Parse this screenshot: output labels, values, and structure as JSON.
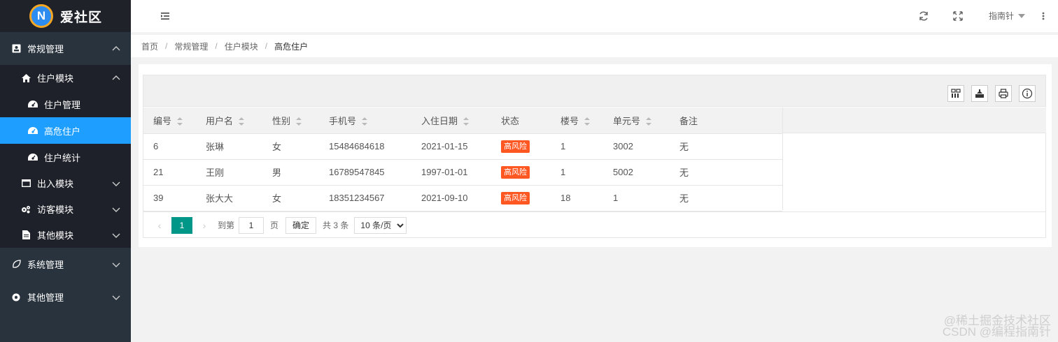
{
  "app": {
    "logo_letter": "N",
    "title": "爱社区"
  },
  "sidebar": {
    "groups": [
      {
        "label": "常规管理",
        "icon": "contact-card-icon",
        "expanded": true,
        "modules": [
          {
            "label": "住户模块",
            "icon": "home-icon",
            "expanded": true,
            "items": [
              {
                "label": "住户管理",
                "icon": "dashboard-icon"
              },
              {
                "label": "高危住户",
                "icon": "dashboard-icon",
                "active": true
              },
              {
                "label": "住户统计",
                "icon": "dashboard-icon"
              }
            ]
          },
          {
            "label": "出入模块",
            "icon": "window-icon"
          },
          {
            "label": "访客模块",
            "icon": "gears-icon"
          },
          {
            "label": "其他模块",
            "icon": "file-icon"
          }
        ]
      },
      {
        "label": "系统管理",
        "icon": "leaf-icon"
      },
      {
        "label": "其他管理",
        "icon": "soccer-icon"
      }
    ]
  },
  "topbar": {
    "user": "指南针"
  },
  "breadcrumb": [
    "首页",
    "常规管理",
    "住户模块",
    "高危住户"
  ],
  "table": {
    "columns": [
      {
        "label": "编号",
        "sortable": true
      },
      {
        "label": "用户名",
        "sortable": true
      },
      {
        "label": "性别",
        "sortable": true
      },
      {
        "label": "手机号",
        "sortable": true
      },
      {
        "label": "入住日期",
        "sortable": true
      },
      {
        "label": "状态",
        "sortable": false
      },
      {
        "label": "楼号",
        "sortable": true
      },
      {
        "label": "单元号",
        "sortable": true
      },
      {
        "label": "备注",
        "sortable": false
      }
    ],
    "rows": [
      [
        "6",
        "张琳",
        "女",
        "15484684618",
        "2021-01-15",
        "高风险",
        "1",
        "3002",
        "无"
      ],
      [
        "21",
        "王刚",
        "男",
        "16789547845",
        "1997-01-01",
        "高风险",
        "1",
        "5002",
        "无"
      ],
      [
        "39",
        "张大大",
        "女",
        "18351234567",
        "2021-09-10",
        "高风险",
        "18",
        "1",
        "无"
      ]
    ]
  },
  "pager": {
    "current": "1",
    "goto_label": "到第",
    "goto_value": "1",
    "page_suffix": "页",
    "confirm": "确定",
    "total": "共 3 条",
    "page_size": "10 条/页"
  },
  "watermark": {
    "line1": "@稀土掘金技术社区",
    "line2": "CSDN @编程指南针"
  }
}
